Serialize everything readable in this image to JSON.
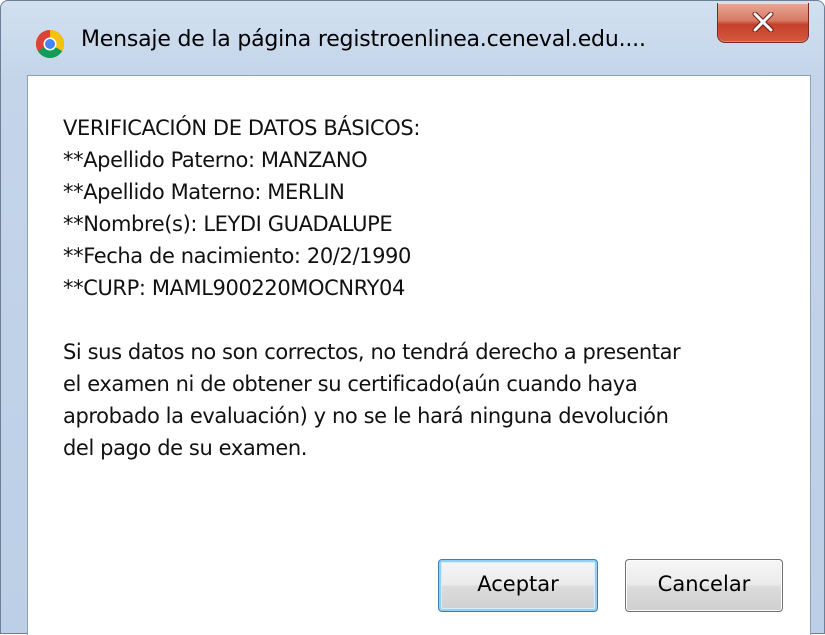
{
  "dialog": {
    "title": "Mensaje de la página registroenlinea.ceneval.edu....",
    "close_label": "Cerrar",
    "message_lines": [
      "VERIFICACIÓN DE DATOS BÁSICOS:",
      "**Apellido Paterno: MANZANO",
      "**Apellido Materno: MERLIN",
      "**Nombre(s): LEYDI GUADALUPE",
      "**Fecha de nacimiento: 20/2/1990",
      "**CURP: MAML900220MOCNRY04"
    ],
    "warning_lines": [
      "Si sus datos no son correctos, no tendrá derecho a presentar",
      "el examen ni de obtener su certificado(aún cuando haya",
      "aprobado la evaluación) y no se le hará ninguna devolución",
      "del pago de su examen."
    ],
    "ok_label": "Aceptar",
    "cancel_label": "Cancelar"
  },
  "icons": {
    "app": "chrome-icon",
    "close": "close-icon"
  },
  "colors": {
    "frame": "#bccfe6",
    "close_button": "#c4402a",
    "default_button_border": "#3c7fb1"
  }
}
